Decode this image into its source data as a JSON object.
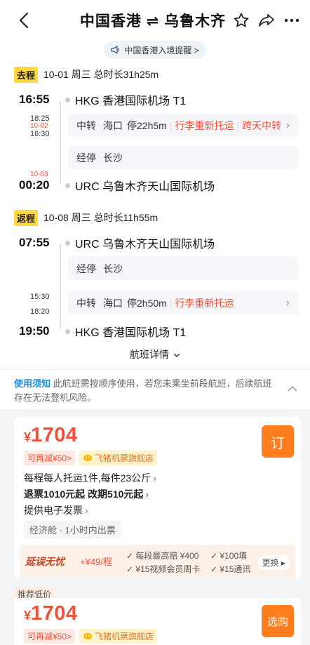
{
  "header": {
    "title": "中国香港 ⇌ 乌鲁木齐"
  },
  "notice": {
    "text": "中国香港入境提醒 >"
  },
  "outbound": {
    "tag": "去程",
    "summary": "10-01  周三  总时长31h25m",
    "dep_time": "16:55",
    "dep_airport": "HKG 香港国际机场 T1",
    "transfer_arr_time": "18:25",
    "transfer_arr_date": "10-02",
    "transfer_dep_time": "16:30",
    "transfer_label": "中转",
    "transfer_city": "海口",
    "transfer_stay": "停22h5m",
    "transfer_note1": "行李重新托运",
    "transfer_note2": "跨天中转",
    "stop_label": "经停",
    "stop_city": "长沙",
    "arr_date": "10-03",
    "arr_time": "00:20",
    "arr_airport": "URC 乌鲁木齐天山国际机场"
  },
  "return": {
    "tag": "返程",
    "summary": "10-08  周三  总时长11h55m",
    "dep_time": "07:55",
    "dep_airport": "URC 乌鲁木齐天山国际机场",
    "stop_label": "经停",
    "stop_city": "长沙",
    "transfer_arr_time": "15:30",
    "transfer_dep_time": "18:20",
    "transfer_label": "中转",
    "transfer_city": "海口",
    "transfer_stay": "停2h50m",
    "transfer_note1": "行李重新托运",
    "arr_time": "19:50",
    "arr_airport": "HKG 香港国际机场 T1"
  },
  "flight_details": "航班详情",
  "usage": {
    "title": "使用须知",
    "text": "此航班需按顺序使用，若您未乘坐前段航班，后续航班存在无法登机风险。"
  },
  "offer1": {
    "currency": "¥",
    "price": "1704",
    "discount": "可再减¥50>",
    "store": "飞猪机票旗舰店",
    "book": "订",
    "baggage": "每程每人托运1件,每件23公斤",
    "refund": "退票1010元起 改期510元起",
    "invoice": "提供电子发票",
    "cabin": "经济舱 · 1小时内出票",
    "insure_title": "延误无忧",
    "insure_price": "+¥49/程",
    "benefit1": "✓ 每段最高赔 ¥400",
    "benefit2": "✓ ¥100填",
    "benefit3": "✓ ¥15视频会员周卡",
    "benefit4": "✓ ¥15通讯",
    "change": "更换 ▸"
  },
  "offer2": {
    "tag": "推荐低价",
    "currency": "¥",
    "price": "1704",
    "discount": "可再减¥50>",
    "store": "飞猪机票旗舰店",
    "book": "选购"
  },
  "colors": {
    "accent_red": "#f1513a",
    "book_orange": "#ff7c1f",
    "tag_yellow": "#ffd83d",
    "link_blue": "#1a8fd6"
  },
  "icons": [
    "back-icon",
    "star-icon",
    "share-icon",
    "more-icon",
    "megaphone-icon",
    "chevron-down-icon",
    "store-icon"
  ]
}
